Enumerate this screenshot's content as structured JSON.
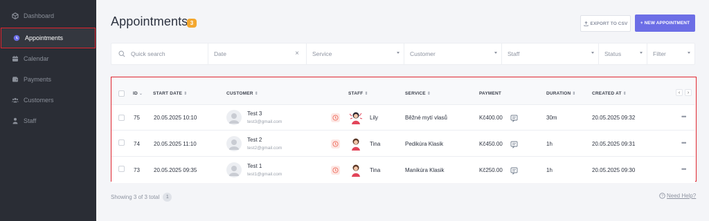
{
  "sidebar": {
    "items": [
      {
        "label": "Dashboard",
        "icon": "cube-icon"
      },
      {
        "label": "Appointments",
        "icon": "clock-icon"
      },
      {
        "label": "Calendar",
        "icon": "calendar-icon"
      },
      {
        "label": "Payments",
        "icon": "wallet-icon"
      },
      {
        "label": "Customers",
        "icon": "users-icon"
      },
      {
        "label": "Staff",
        "icon": "user-icon"
      }
    ]
  },
  "header": {
    "title": "Appointments",
    "count": "3",
    "export_label": "EXPORT TO CSV",
    "new_label": "+ NEW APPOINTMENT"
  },
  "filters": {
    "search_placeholder": "Quick search",
    "date": "Date",
    "service": "Service",
    "customer": "Customer",
    "staff": "Staff",
    "status": "Status",
    "filter": "Filter"
  },
  "table": {
    "columns": {
      "id": "ID",
      "start_date": "START DATE",
      "customer": "CUSTOMER",
      "staff": "STAFF",
      "service": "SERVICE",
      "payment": "PAYMENT",
      "duration": "DURATION",
      "created_at": "CREATED AT"
    },
    "rows": [
      {
        "id": "75",
        "start": "20.05.2025 10:10",
        "customer_name": "Test 3",
        "customer_email": "test3@gmail.com",
        "staff": "Lily",
        "service": "Běžné mytí vlasů",
        "payment": "Kč400.00",
        "duration": "30m",
        "created": "20.05.2025 09:32"
      },
      {
        "id": "74",
        "start": "20.05.2025 11:10",
        "customer_name": "Test 2",
        "customer_email": "test2@gmail.com",
        "staff": "Tina",
        "service": "Pedikúra Klasik",
        "payment": "Kč450.00",
        "duration": "1h",
        "created": "20.05.2025 09:31"
      },
      {
        "id": "73",
        "start": "20.05.2025 09:35",
        "customer_name": "Test 1",
        "customer_email": "test1@gmail.com",
        "staff": "Tina",
        "service": "Manikúra Klasik",
        "payment": "Kč250.00",
        "duration": "1h",
        "created": "20.05.2025 09:30"
      }
    ]
  },
  "footer": {
    "showing": "Showing 3 of 3 total",
    "page": "1",
    "help": "Need Help?"
  },
  "colors": {
    "accent": "#6c6ee6",
    "badge": "#f3a72f",
    "highlight": "#e0242e",
    "sidebar_bg": "#2a2d35"
  }
}
